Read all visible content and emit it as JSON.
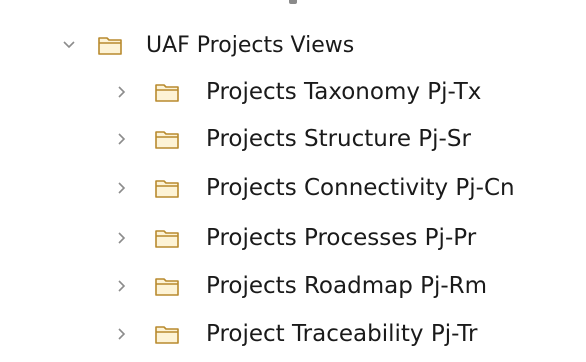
{
  "tree": {
    "parent": {
      "label": "UAF Projects Views",
      "expanded": true,
      "icon": "folder-icon"
    },
    "children": [
      {
        "label": "Projects Taxonomy Pj-Tx",
        "icon": "folder-icon",
        "expanded": false
      },
      {
        "label": "Projects Structure Pj-Sr",
        "icon": "folder-icon",
        "expanded": false
      },
      {
        "label": "Projects Connectivity Pj-Cn",
        "icon": "folder-icon",
        "expanded": false
      },
      {
        "label": "Projects Processes Pj-Pr",
        "icon": "folder-icon",
        "expanded": false
      },
      {
        "label": "Projects Roadmap Pj-Rm",
        "icon": "folder-icon",
        "expanded": false
      },
      {
        "label": "Project Traceability Pj-Tr",
        "icon": "folder-icon",
        "expanded": false
      }
    ]
  },
  "colors": {
    "folder_stroke": "#b88a2e",
    "folder_fill": "#fdf3d6",
    "chevron": "#8c8c8c",
    "text": "#1a1a1a"
  }
}
